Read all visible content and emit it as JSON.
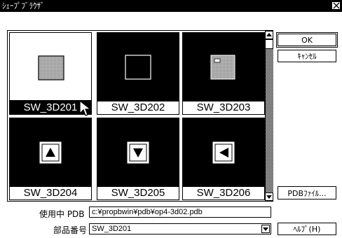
{
  "window": {
    "title": "ｼｪｰﾌﾟﾌﾞﾗｳｻﾞ"
  },
  "shapes": [
    {
      "label": "SW_3D201",
      "glyph": "filled-square"
    },
    {
      "label": "SW_3D202",
      "glyph": "outline-square"
    },
    {
      "label": "SW_3D203",
      "glyph": "small-square-mark"
    },
    {
      "label": "SW_3D204",
      "glyph": "up-triangle"
    },
    {
      "label": "SW_3D205",
      "glyph": "down-triangle"
    },
    {
      "label": "SW_3D206",
      "glyph": "left-triangle"
    }
  ],
  "buttons": {
    "ok": "OK",
    "cancel": "ｷｬﾝｾﾙ",
    "pdb": "PDBﾌｧｲﾙ...",
    "help": "ﾍﾙﾌﾟ(H)"
  },
  "fields": {
    "pdb_label": "使用中 PDB",
    "pdb_value": "c:¥propbwin¥pdb¥op4-3d02.pdb",
    "part_label": "部品番号",
    "part_value": "SW_3D201"
  },
  "icons": {
    "close": "close-icon",
    "scroll_up": "arrow-up-icon",
    "scroll_down": "arrow-down-icon",
    "combo": "chevron-down-icon",
    "cursor": "mouse-pointer-icon"
  }
}
